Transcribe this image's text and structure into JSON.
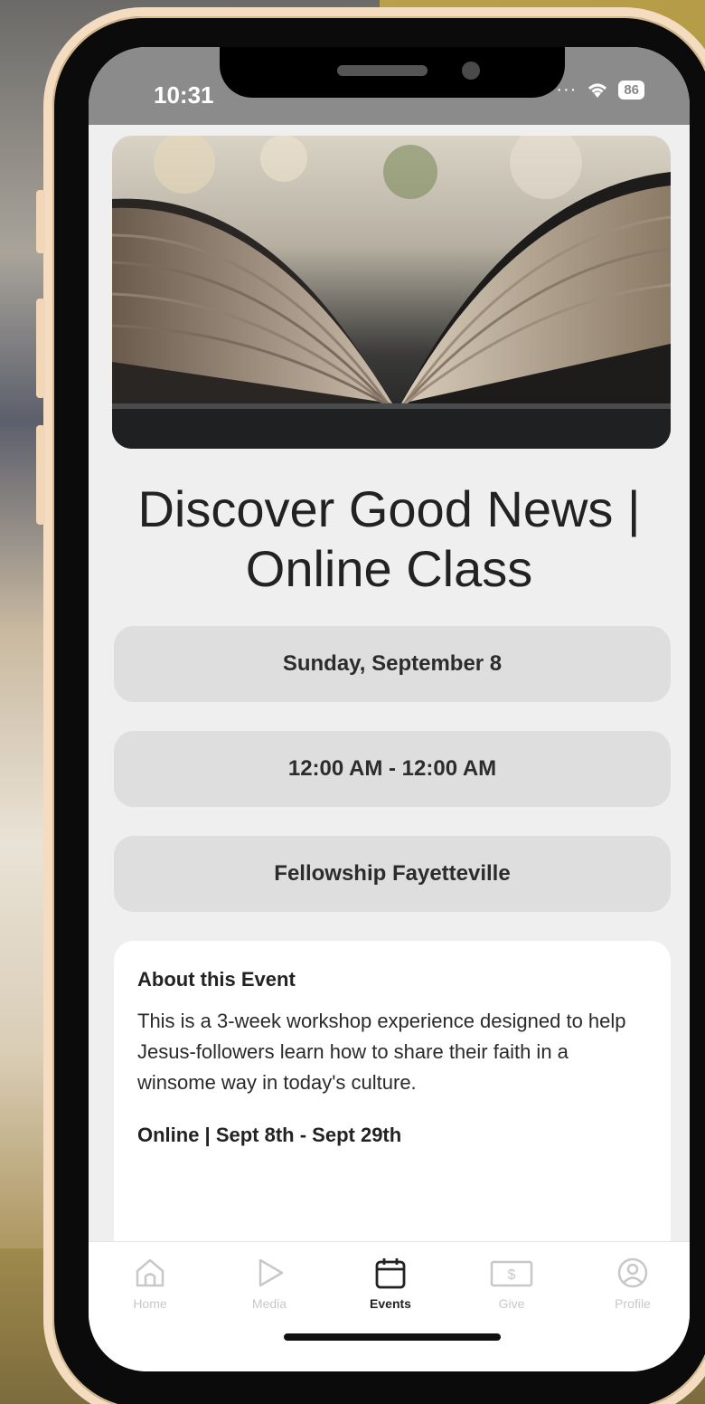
{
  "status_bar": {
    "time": "10:31",
    "battery": "86"
  },
  "event": {
    "title_line1": "Discover Good News |",
    "title_line2": "Online Class",
    "date": "Sunday, September 8",
    "time_range": "12:00 AM - 12:00 AM",
    "location": "Fellowship Fayetteville"
  },
  "about": {
    "heading": "About this Event",
    "body": "This is a 3-week workshop experience designed to help Jesus-followers learn how to share their faith in a winsome way in today's culture.",
    "subheading": "Online | Sept 8th - Sept 29th"
  },
  "tabs": [
    {
      "label": "Home",
      "icon": "home-icon",
      "active": false
    },
    {
      "label": "Media",
      "icon": "play-icon",
      "active": false
    },
    {
      "label": "Events",
      "icon": "calendar-icon",
      "active": true
    },
    {
      "label": "Give",
      "icon": "dollar-icon",
      "active": false
    },
    {
      "label": "Profile",
      "icon": "profile-icon",
      "active": false
    }
  ],
  "colors": {
    "active_tab": "#222222",
    "inactive_tab": "#c8c8c8",
    "pill_bg": "#dedede",
    "status_bar_bg": "#8b8b8b"
  }
}
